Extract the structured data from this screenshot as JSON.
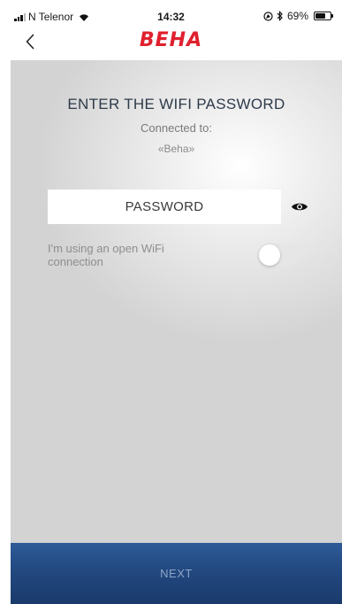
{
  "status_bar": {
    "carrier": "N Telenor",
    "time": "14:32",
    "battery_percent": "69%",
    "battery_level": 0.69,
    "icons": [
      "signal-icon",
      "wifi-icon",
      "location-icon",
      "bluetooth-icon",
      "battery-icon"
    ]
  },
  "nav": {
    "logo_text": "BEHA",
    "back_icon": "chevron-left-icon"
  },
  "main": {
    "heading": "ENTER THE WIFI PASSWORD",
    "connected_label": "Connected to:",
    "network_name": "«Beha»",
    "password_placeholder": "PASSWORD",
    "eye_icon": "eye-icon",
    "open_wifi_label": "I'm using an open WiFi connection",
    "open_wifi_toggle_on": false
  },
  "footer": {
    "next_label": "NEXT"
  },
  "colors": {
    "logo": "#e0202e",
    "heading": "#2e3a4a",
    "button_bg": "#234a82",
    "button_text": "#8ea5c6"
  }
}
